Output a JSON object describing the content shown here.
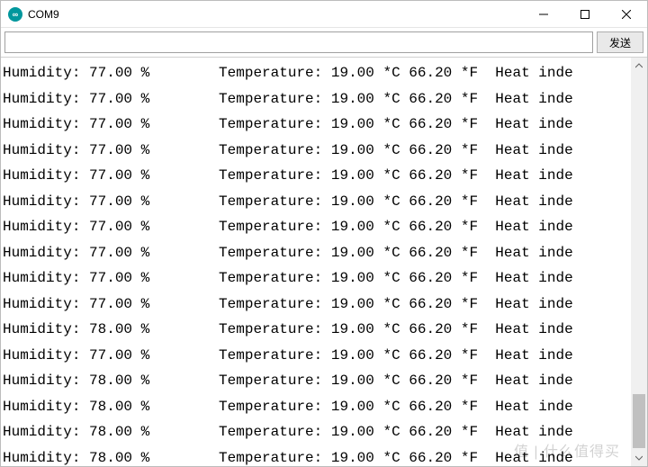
{
  "window": {
    "title": "COM9",
    "app_icon_glyph": "∞"
  },
  "toolbar": {
    "input_value": "",
    "input_placeholder": "",
    "send_label": "发送"
  },
  "terminal": {
    "columns": {
      "humidity_label": "Humidity:",
      "temperature_label": "Temperature:",
      "heat_index_label": "Heat inde"
    },
    "rows": [
      {
        "humidity": "77.00 %",
        "temp_c": "19.00 *C",
        "temp_f": "66.20 *F"
      },
      {
        "humidity": "77.00 %",
        "temp_c": "19.00 *C",
        "temp_f": "66.20 *F"
      },
      {
        "humidity": "77.00 %",
        "temp_c": "19.00 *C",
        "temp_f": "66.20 *F"
      },
      {
        "humidity": "77.00 %",
        "temp_c": "19.00 *C",
        "temp_f": "66.20 *F"
      },
      {
        "humidity": "77.00 %",
        "temp_c": "19.00 *C",
        "temp_f": "66.20 *F"
      },
      {
        "humidity": "77.00 %",
        "temp_c": "19.00 *C",
        "temp_f": "66.20 *F"
      },
      {
        "humidity": "77.00 %",
        "temp_c": "19.00 *C",
        "temp_f": "66.20 *F"
      },
      {
        "humidity": "77.00 %",
        "temp_c": "19.00 *C",
        "temp_f": "66.20 *F"
      },
      {
        "humidity": "77.00 %",
        "temp_c": "19.00 *C",
        "temp_f": "66.20 *F"
      },
      {
        "humidity": "77.00 %",
        "temp_c": "19.00 *C",
        "temp_f": "66.20 *F"
      },
      {
        "humidity": "78.00 %",
        "temp_c": "19.00 *C",
        "temp_f": "66.20 *F"
      },
      {
        "humidity": "77.00 %",
        "temp_c": "19.00 *C",
        "temp_f": "66.20 *F"
      },
      {
        "humidity": "78.00 %",
        "temp_c": "19.00 *C",
        "temp_f": "66.20 *F"
      },
      {
        "humidity": "78.00 %",
        "temp_c": "19.00 *C",
        "temp_f": "66.20 *F"
      },
      {
        "humidity": "78.00 %",
        "temp_c": "19.00 *C",
        "temp_f": "66.20 *F"
      },
      {
        "humidity": "78.00 %",
        "temp_c": "19.00 *C",
        "temp_f": "66.20 *F"
      }
    ]
  },
  "watermark": "值 | 什么值得买"
}
